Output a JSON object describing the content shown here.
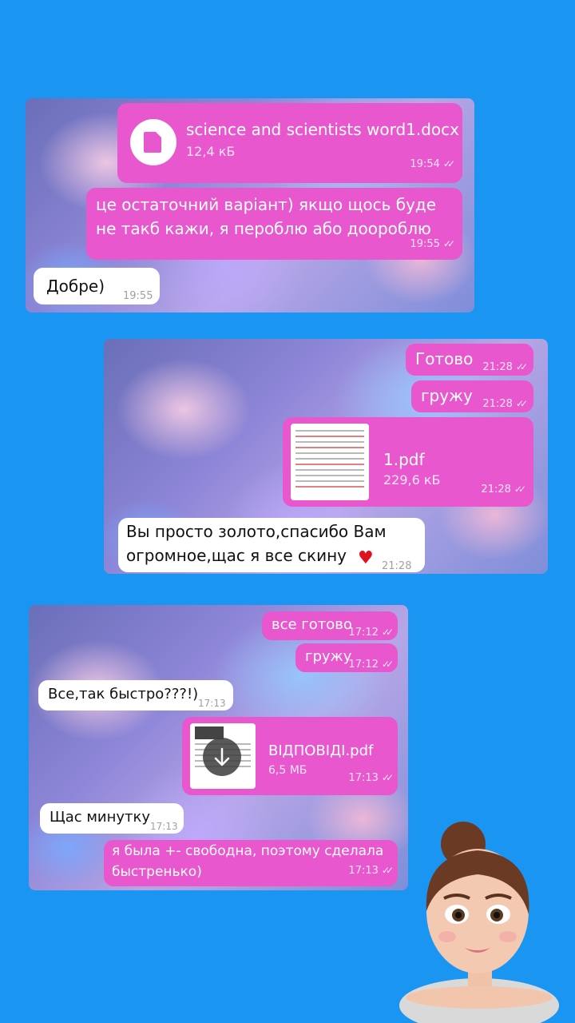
{
  "chat1": {
    "file": {
      "name": "science and scientists word1.docx",
      "size": "12,4 кБ",
      "time": "19:54"
    },
    "msg1": {
      "line1": "це остаточний варіант) якщо щось буде",
      "line2": "не такб кажи, я пероблю або доороблю",
      "time": "19:55"
    },
    "reply": {
      "text": "Добре)",
      "time": "19:55"
    }
  },
  "chat2": {
    "msg1": {
      "text": "Готово",
      "time": "21:28"
    },
    "msg2": {
      "text": "гружу",
      "time": "21:28"
    },
    "file": {
      "name": "1.pdf",
      "size": "229,6 кБ",
      "time": "21:28"
    },
    "reply": {
      "line1": "Вы просто золото,спасибо Вам",
      "line2": "огромное,щас я все скину",
      "time": "21:28"
    }
  },
  "chat3": {
    "msg1": {
      "text": "все готово",
      "time": "17:12"
    },
    "msg2": {
      "text": "гружу",
      "time": "17:12"
    },
    "reply1": {
      "text": "Все,так быстро???!)",
      "time": "17:13"
    },
    "file": {
      "name": "ВІДПОВІДІ.pdf",
      "size": "6,5 МБ",
      "time": "17:13"
    },
    "reply2": {
      "text": "Щас минутку",
      "time": "17:13"
    },
    "msg3": {
      "line1": "я была +- свободна, поэтому сделала",
      "line2": "быстренько)",
      "time": "17:13"
    }
  },
  "icons": {
    "check": "✓✓",
    "heart": "♥"
  },
  "colors": {
    "background": "#1a96f2",
    "outgoing": "#e957cf",
    "incoming": "#ffffff"
  }
}
